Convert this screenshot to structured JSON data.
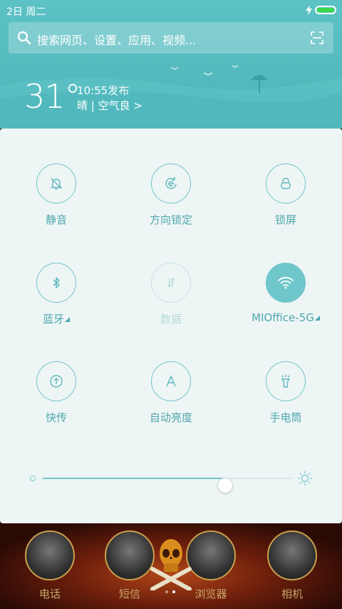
{
  "status_bar": {
    "date": "2日 周二",
    "battery_level": 1.0,
    "charging": true
  },
  "search": {
    "placeholder": "搜索网页、设置、应用、视频..."
  },
  "weather": {
    "temperature": "31°",
    "publish_time": "10:55发布",
    "condition": "晴 | 空气良 >"
  },
  "toggles": [
    {
      "label": "静音",
      "icon": "bell-off-icon",
      "state": "off"
    },
    {
      "label": "方向锁定",
      "icon": "rotation-lock-icon",
      "state": "off"
    },
    {
      "label": "锁屏",
      "icon": "lock-icon",
      "state": "off"
    },
    {
      "label": "蓝牙",
      "icon": "bluetooth-icon",
      "state": "off",
      "has_menu": true
    },
    {
      "label": "数据",
      "icon": "mobile-data-icon",
      "state": "disabled"
    },
    {
      "label": "MIOffice-5G",
      "icon": "wifi-icon",
      "state": "on",
      "has_menu": true
    },
    {
      "label": "快传",
      "icon": "share-upload-icon",
      "state": "off"
    },
    {
      "label": "自动亮度",
      "icon": "auto-brightness-icon",
      "state": "off"
    },
    {
      "label": "手电筒",
      "icon": "flashlight-icon",
      "state": "off"
    }
  ],
  "brightness": {
    "value": 0.73
  },
  "dock": {
    "apps": [
      {
        "label": "电话"
      },
      {
        "label": "短信"
      },
      {
        "label": "浏览器"
      },
      {
        "label": "相机"
      }
    ],
    "page_indicator": {
      "pages": 2,
      "current": 2
    }
  },
  "colors": {
    "accent": "#6fc6cb",
    "header": "#56bcc0",
    "panel_bg": "#eef5f5",
    "label": "#4fa7ad"
  }
}
